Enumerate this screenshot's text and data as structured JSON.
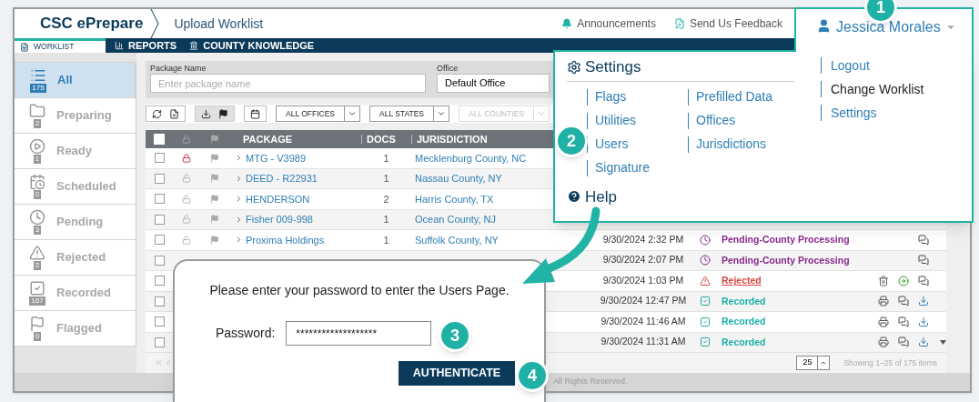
{
  "app": {
    "brand": "CSC ePrepare",
    "page_title": "Upload Worklist"
  },
  "header_links": [
    {
      "label": "Announcements",
      "kind": "bell"
    },
    {
      "label": "Send Us Feedback",
      "kind": "feedback"
    }
  ],
  "nav_tabs": [
    {
      "label": "WORKLIST",
      "kind": "doc",
      "selected": true
    },
    {
      "label": "REPORTS",
      "kind": "chart",
      "selected": false
    },
    {
      "label": "COUNTY KNOWLEDGE",
      "kind": "bank",
      "selected": false
    }
  ],
  "sidebar": [
    {
      "label": "All",
      "count": "175",
      "kind": "all",
      "selected": true
    },
    {
      "label": "Preparing",
      "count": "2",
      "kind": "preparing",
      "selected": false
    },
    {
      "label": "Ready",
      "count": "1",
      "kind": "ready",
      "selected": false
    },
    {
      "label": "Scheduled",
      "count": "0",
      "kind": "scheduled",
      "selected": false
    },
    {
      "label": "Pending",
      "count": "3",
      "kind": "pending",
      "selected": false
    },
    {
      "label": "Rejected",
      "count": "2",
      "kind": "rejected",
      "selected": false
    },
    {
      "label": "Recorded",
      "count": "167",
      "kind": "recorded",
      "selected": false
    },
    {
      "label": "Flagged",
      "count": "0",
      "kind": "flagged",
      "selected": false
    }
  ],
  "filters": {
    "package_name": {
      "label": "Package Name",
      "placeholder": "Enter package name"
    },
    "office": {
      "label": "Office",
      "value": "Default Office"
    }
  },
  "toolbar": {
    "dropdowns": [
      {
        "label": "ALL OFFICES",
        "disabled": false
      },
      {
        "label": "ALL STATES",
        "disabled": false
      },
      {
        "label": "ALL COUNTIES",
        "disabled": true
      }
    ]
  },
  "table": {
    "select_all_checked": false,
    "columns": [
      "PACKAGE",
      "DOCS",
      "JURISDICTION"
    ],
    "rows": [
      {
        "checked": false,
        "locked": true,
        "package": "MTG - V3989",
        "docs": "1",
        "jurisdiction": "Mecklenburg County, NC"
      },
      {
        "checked": false,
        "locked": false,
        "package": "DEED - R22931",
        "docs": "1",
        "jurisdiction": "Nassau County, NY"
      },
      {
        "checked": false,
        "locked": false,
        "package": "HENDERSON",
        "docs": "2",
        "jurisdiction": "Harris County, TX"
      },
      {
        "checked": false,
        "locked": false,
        "package": "Fisher 009-998",
        "docs": "1",
        "jurisdiction": "Ocean County, NJ"
      },
      {
        "checked": false,
        "locked": false,
        "package": "Proxima Holdings",
        "docs": "1",
        "jurisdiction": "Suffolk County, NY",
        "date": "9/30/2024 2:32 PM",
        "status": "Pending-County Processing",
        "kind": "pending",
        "actions": [
          {
            "kind": "comment"
          }
        ]
      },
      {
        "checked": false,
        "date": "9/30/2024 2:07 PM",
        "status": "Pending-County Processing",
        "kind": "pending",
        "actions": [
          {
            "kind": "comment"
          }
        ]
      },
      {
        "checked": false,
        "date": "9/30/2024 1:03 PM",
        "status": "Rejected",
        "kind": "rejected",
        "actions": [
          {
            "kind": "delete"
          },
          {
            "kind": "next"
          },
          {
            "kind": "comment"
          }
        ]
      },
      {
        "checked": false,
        "date": "9/30/2024 12:47 PM",
        "status": "Recorded",
        "kind": "recorded",
        "actions": [
          {
            "kind": "print"
          },
          {
            "kind": "comment"
          },
          {
            "kind": "download"
          }
        ]
      },
      {
        "checked": false,
        "date": "9/30/2024 11:46 AM",
        "status": "Recorded",
        "kind": "recorded",
        "actions": [
          {
            "kind": "print"
          },
          {
            "kind": "comment"
          },
          {
            "kind": "download"
          }
        ]
      },
      {
        "checked": false,
        "date": "9/30/2024 11:31 AM",
        "status": "Recorded",
        "kind": "recorded",
        "actions": [
          {
            "kind": "print"
          },
          {
            "kind": "comment"
          },
          {
            "kind": "download"
          }
        ]
      }
    ]
  },
  "pager": {
    "page_size": "25",
    "summary": "Showing 1–25 of 175 items"
  },
  "footer": "All Rights Reserved.",
  "user_menu": {
    "name": "Jessica Morales",
    "expanded": true,
    "settings_title": "Settings",
    "settings_columns": [
      [
        "Flags",
        "Utilities",
        "Users",
        "Signature"
      ],
      [
        "Prefilled Data",
        "Offices",
        "Jurisdictions"
      ]
    ],
    "account_links": [
      {
        "label": "Logout",
        "kind": "link"
      },
      {
        "label": "Change Worklist",
        "kind": "text"
      },
      {
        "label": "Settings",
        "kind": "link"
      }
    ],
    "help": "Help"
  },
  "dialog": {
    "message": "Please enter your password to enter the Users Page.",
    "password_label": "Password:",
    "password_value": "*******************",
    "button": "AUTHENTICATE"
  },
  "callouts": [
    "1",
    "2",
    "3",
    "4"
  ]
}
